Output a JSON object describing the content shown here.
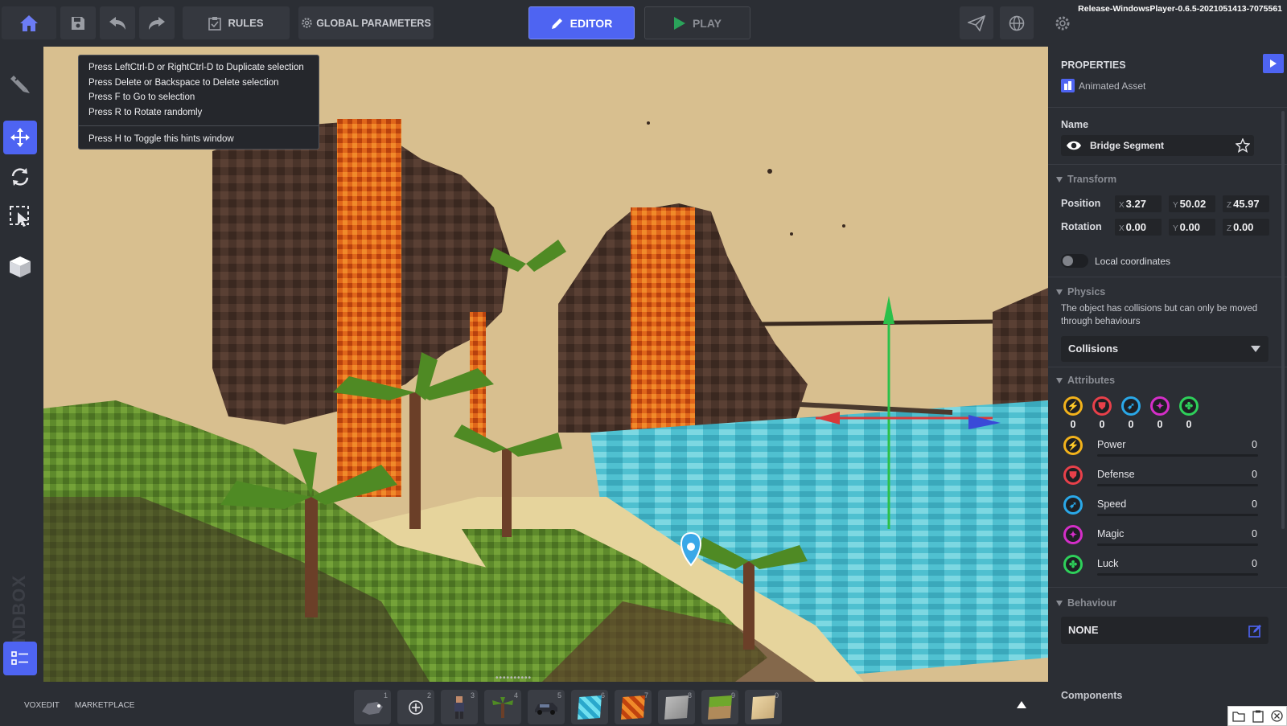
{
  "topbar": {
    "rules_label": "RULES",
    "global_label": "GLOBAL PARAMETERS",
    "editor_label": "EDITOR",
    "play_label": "PLAY",
    "version": "Release-WindowsPlayer-0.6.5-2021051413-7075561",
    "icons": [
      "home-icon",
      "save-icon",
      "undo-icon",
      "redo-icon",
      "rules-icon",
      "gear-icon",
      "pencil-icon",
      "play-icon",
      "paper-plane-icon",
      "globe-icon",
      "settings-icon"
    ]
  },
  "hints": {
    "lines": [
      "Press LeftCtrl-D or RightCtrl-D to Duplicate selection",
      "Press Delete or Backspace to Delete selection",
      "Press F to Go to selection",
      "Press R to Rotate randomly"
    ],
    "toggle_line": "Press H to Toggle this hints window"
  },
  "leftbar": {
    "logo": "SANDBOX",
    "tools": [
      "brush-icon",
      "move-icon",
      "rotate-icon",
      "select-icon",
      "cube-icon",
      "list-icon"
    ]
  },
  "bottombar": {
    "voxedit": "VOXEDIT",
    "marketplace": "MARKETPLACE",
    "slots": [
      {
        "num": "1",
        "icon": "creature-icon"
      },
      {
        "num": "2",
        "icon": "add-icon"
      },
      {
        "num": "3",
        "icon": "character-icon"
      },
      {
        "num": "4",
        "icon": "tree-icon"
      },
      {
        "num": "5",
        "icon": "car-icon"
      },
      {
        "num": "6",
        "icon": "water-block-icon"
      },
      {
        "num": "7",
        "icon": "lava-block-icon"
      },
      {
        "num": "8",
        "icon": "stone-block-icon"
      },
      {
        "num": "9",
        "icon": "grass-block-icon"
      },
      {
        "num": "0",
        "icon": "sand-block-icon"
      }
    ]
  },
  "panel": {
    "title": "PROPERTIES",
    "asset_type": "Animated Asset",
    "name_label": "Name",
    "name_value": "Bridge Segment",
    "transform": {
      "section": "Transform",
      "position_label": "Position",
      "rotation_label": "Rotation",
      "position": {
        "x": "3.27",
        "y": "50.02",
        "z": "45.97"
      },
      "rotation": {
        "x": "0.00",
        "y": "0.00",
        "z": "0.00"
      },
      "local_coordinates": "Local coordinates"
    },
    "physics": {
      "section": "Physics",
      "description": "The object has collisions but can only be moved through behaviours",
      "dropdown": "Collisions"
    },
    "attributes": {
      "section": "Attributes",
      "items": [
        {
          "name": "Power",
          "value": "0",
          "color": "#f2b21b",
          "glyph": "⚡"
        },
        {
          "name": "Defense",
          "value": "0",
          "color": "#e8404a",
          "glyph": "⛊"
        },
        {
          "name": "Speed",
          "value": "0",
          "color": "#2aa8e8",
          "glyph": "➶"
        },
        {
          "name": "Magic",
          "value": "0",
          "color": "#d42ec8",
          "glyph": "✦"
        },
        {
          "name": "Luck",
          "value": "0",
          "color": "#2ed05a",
          "glyph": "✤"
        }
      ]
    },
    "behaviour": {
      "section": "Behaviour",
      "value": "NONE"
    },
    "components_label": "Components"
  }
}
